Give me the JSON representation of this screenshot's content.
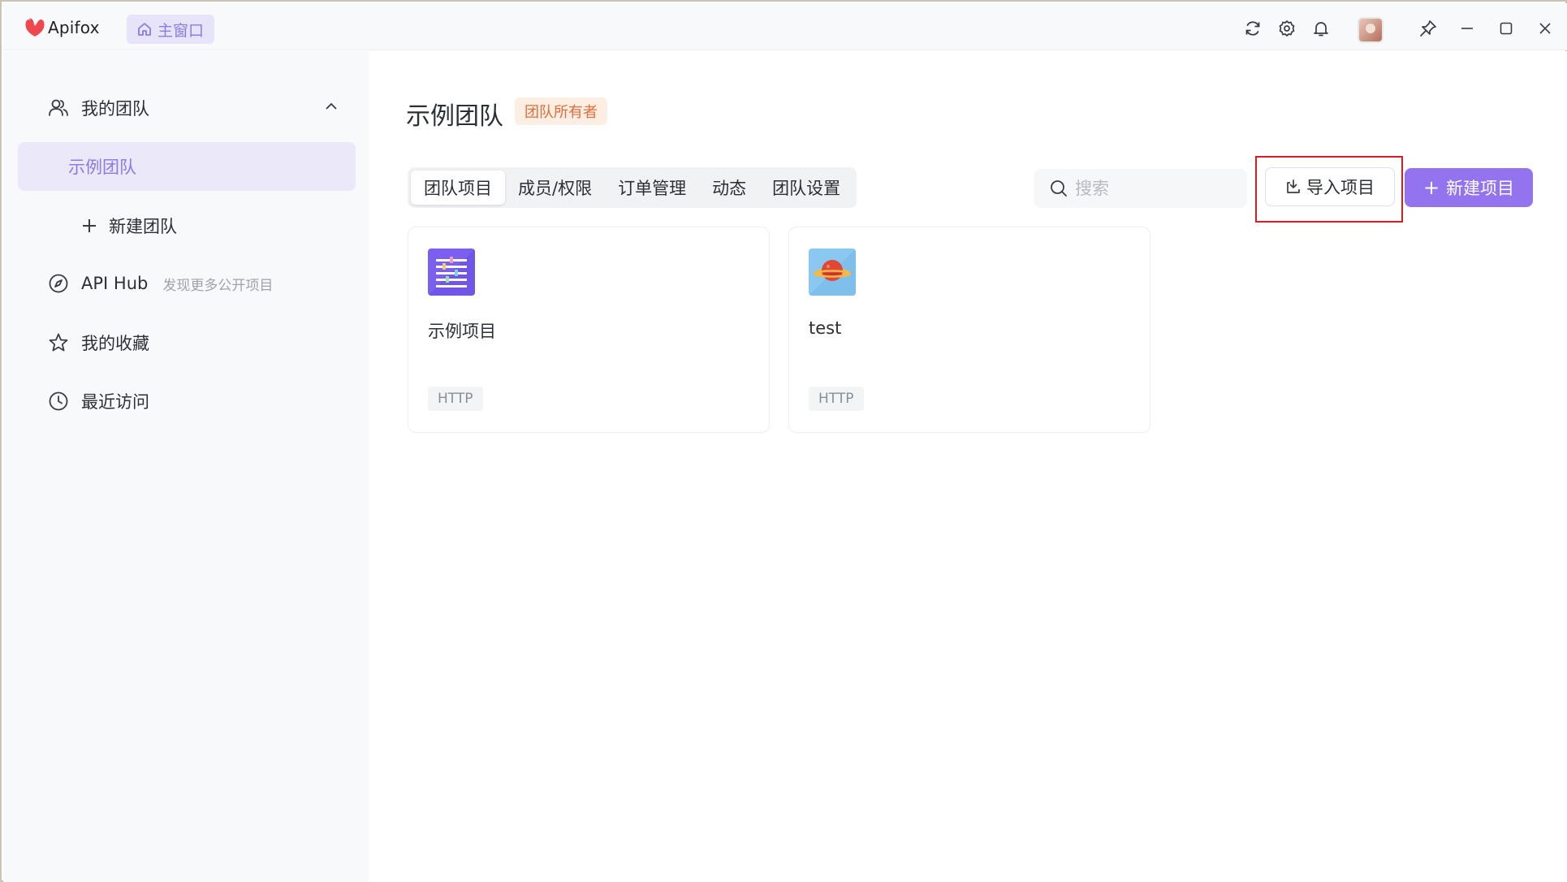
{
  "app": {
    "name": "Apifox",
    "home_tab": "主窗口"
  },
  "titlebar": {
    "icons": [
      "sync-icon",
      "settings-icon",
      "bell-icon",
      "avatar",
      "pin-icon",
      "minimize-icon",
      "maximize-icon",
      "close-icon"
    ]
  },
  "sidebar": {
    "my_teams": "我的团队",
    "selected_team": "示例团队",
    "new_team": "新建团队",
    "api_hub": "API Hub",
    "api_hub_sub": "发现更多公开项目",
    "favorites": "我的收藏",
    "recent": "最近访问"
  },
  "main": {
    "team_title": "示例团队",
    "owner_badge": "团队所有者",
    "tabs": [
      {
        "label": "团队项目",
        "active": true
      },
      {
        "label": "成员/权限",
        "active": false
      },
      {
        "label": "订单管理",
        "active": false
      },
      {
        "label": "动态",
        "active": false
      },
      {
        "label": "团队设置",
        "active": false
      }
    ],
    "search_placeholder": "搜索",
    "import_label": "导入项目",
    "new_label": "新建项目",
    "projects": [
      {
        "name": "示例项目",
        "tag": "HTTP",
        "icon": "list-project-icon"
      },
      {
        "name": "test",
        "tag": "HTTP",
        "icon": "planet-project-icon"
      }
    ]
  },
  "colors": {
    "accent": "#9373ee",
    "accent_light": "#ebe8f9",
    "highlight_border": "#d91c24",
    "owner_badge_bg": "#fdeee4",
    "owner_badge_text": "#e36d3b"
  }
}
